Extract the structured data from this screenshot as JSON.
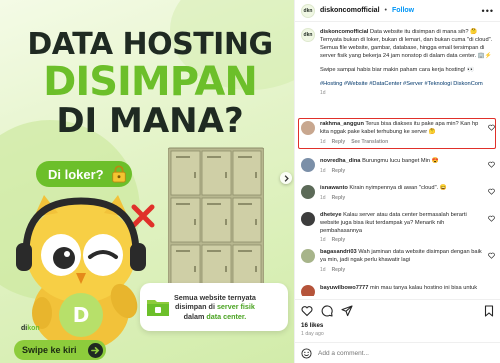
{
  "post_image": {
    "headline_line1": "DATA HOSTING",
    "headline_line2": "DISIMPAN",
    "headline_line3": "DI MANA?",
    "bubble_text": "Di loker?",
    "info_line1": "Semua website ternyata",
    "info_line2_pre": "disimpan di",
    "info_line2_hl": "server fisik",
    "info_line3_pre": "dalam",
    "info_line3_hl": "data center.",
    "swipe_label": "Swipe ke kiri",
    "brand_mark_pre": "di",
    "brand_mark_accent": "kon",
    "colors": {
      "accent_green": "#6cbf2a",
      "dark_text": "#1f2a22",
      "x_red": "#e0302a"
    }
  },
  "header": {
    "username": "diskoncomofficial",
    "dot": "•",
    "follow_label": "Follow",
    "more_icon": "more-horizontal-icon"
  },
  "caption": {
    "username": "diskoncomofficial",
    "text": "Data website itu disimpan di mana sih? 🤔 Ternyata bukan di loker, bukan di lemari, dan bukan cuma \"di cloud\". Semua file website, gambar, database, hingga email tersimpan di server fisik yang bekerja 24 jam nonstop di dalam data center. 🏢⚡",
    "text2": "Swipe sampai habis biar makin paham cara kerja hosting! 👀",
    "hashtags": "#Hosting #Website #DataCenter #Server #Teknologi DiskonCom",
    "time": "1d"
  },
  "comments": [
    {
      "user": "rakhma_anggun",
      "text": "Terus bisa diakses itu pake apa min? Kan hp kita nggak pake kabel terhubung ke server 🤔",
      "time": "1d",
      "likes": "",
      "reply": "Reply",
      "see_translation": "See Translation",
      "highlighted": true
    },
    {
      "user": "novredha_dina",
      "text": "Burungmu lucu banget Min 😍",
      "time": "1d",
      "reply": "Reply"
    },
    {
      "user": "isnawanto",
      "text": "Kirain nyimpennya di awan \"cloud\". 😄",
      "time": "1d",
      "reply": "Reply"
    },
    {
      "user": "dheteye",
      "text": "Kalau server atau data center bermasalah berarti website juga bisa ikut terdampak ya? Menarik nih pembahasannya",
      "time": "1d",
      "reply": "Reply"
    },
    {
      "user": "bagasandri03",
      "text": "Wah jaminan data website disimpan dengan baik ya min, jadi ngak perlu khawatir lagi",
      "time": "1d",
      "reply": "Reply"
    },
    {
      "user": "bayuwilbowo7777",
      "text": "min mau tanya kalau hostino ini bisa untuk",
      "time": "",
      "reply": ""
    }
  ],
  "actions": {
    "likes": "16 likes",
    "time_ago": "1 day ago"
  },
  "comment_box": {
    "placeholder": "Add a comment..."
  }
}
